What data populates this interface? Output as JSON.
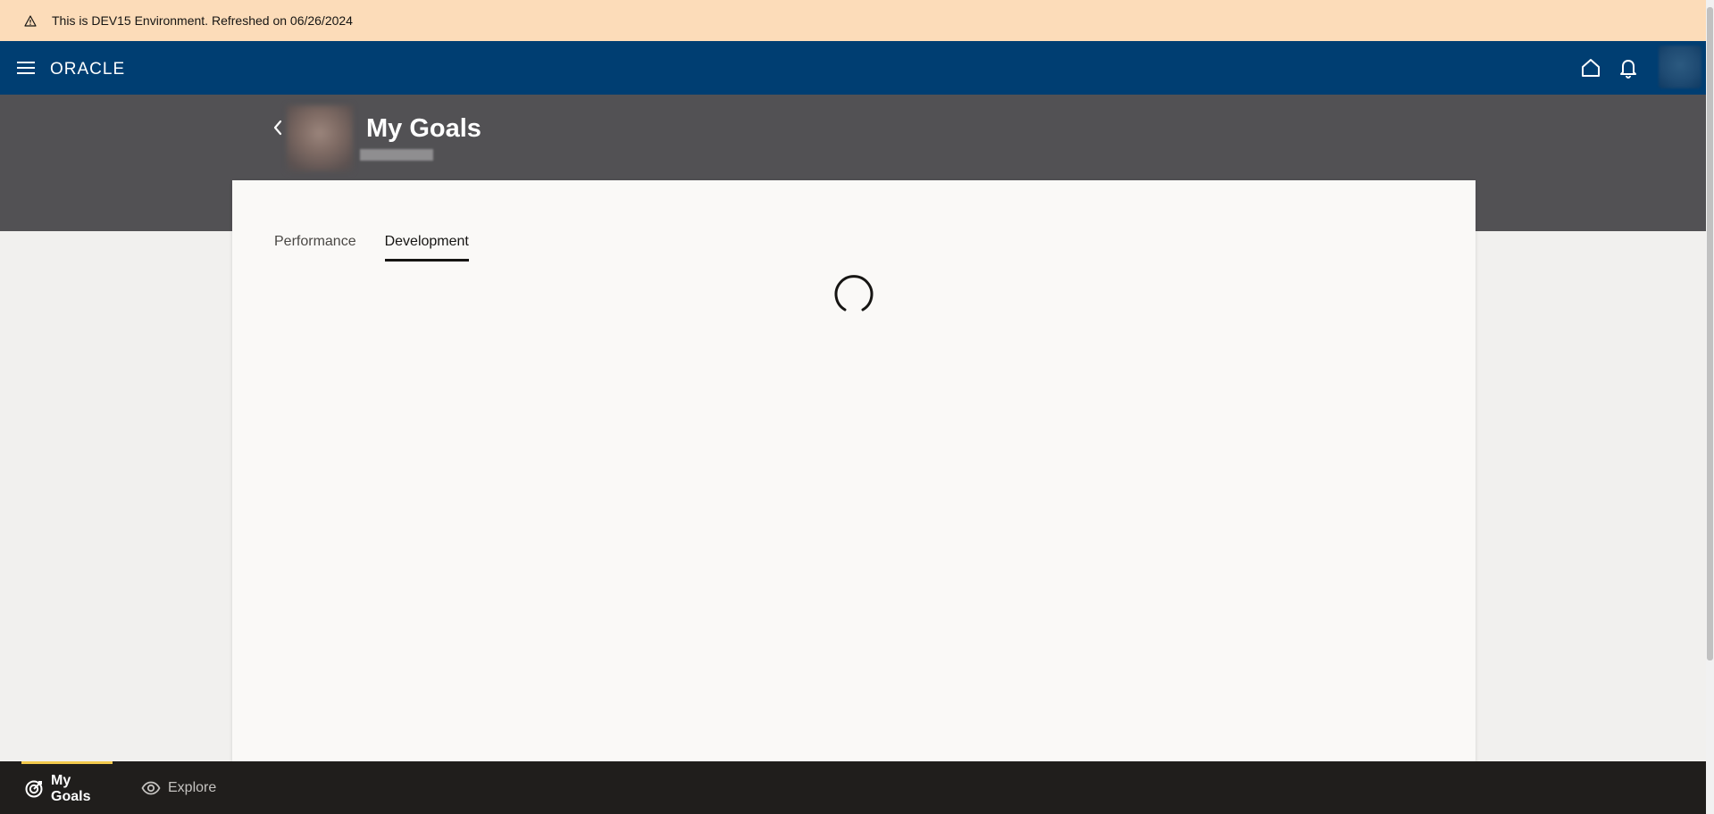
{
  "env_banner": {
    "text": "This is DEV15 Environment. Refreshed on 06/26/2024",
    "icon": "warning-icon",
    "background": "#fcdcb9"
  },
  "topbar": {
    "brand": "ORACLE",
    "background": "#003e72",
    "icons": [
      "menu-icon",
      "home-icon",
      "bell-icon"
    ]
  },
  "header": {
    "title": "My Goals",
    "background": "#525154"
  },
  "tabs": [
    {
      "label": "Performance",
      "active": false
    },
    {
      "label": "Development",
      "active": true
    }
  ],
  "bottom_nav": {
    "items": [
      {
        "label": "My Goals",
        "icon": "target-icon",
        "active": true
      },
      {
        "label": "Explore",
        "icon": "eye-icon",
        "active": false
      }
    ],
    "accent": "#f2c94c"
  },
  "status": {
    "loading": true
  }
}
